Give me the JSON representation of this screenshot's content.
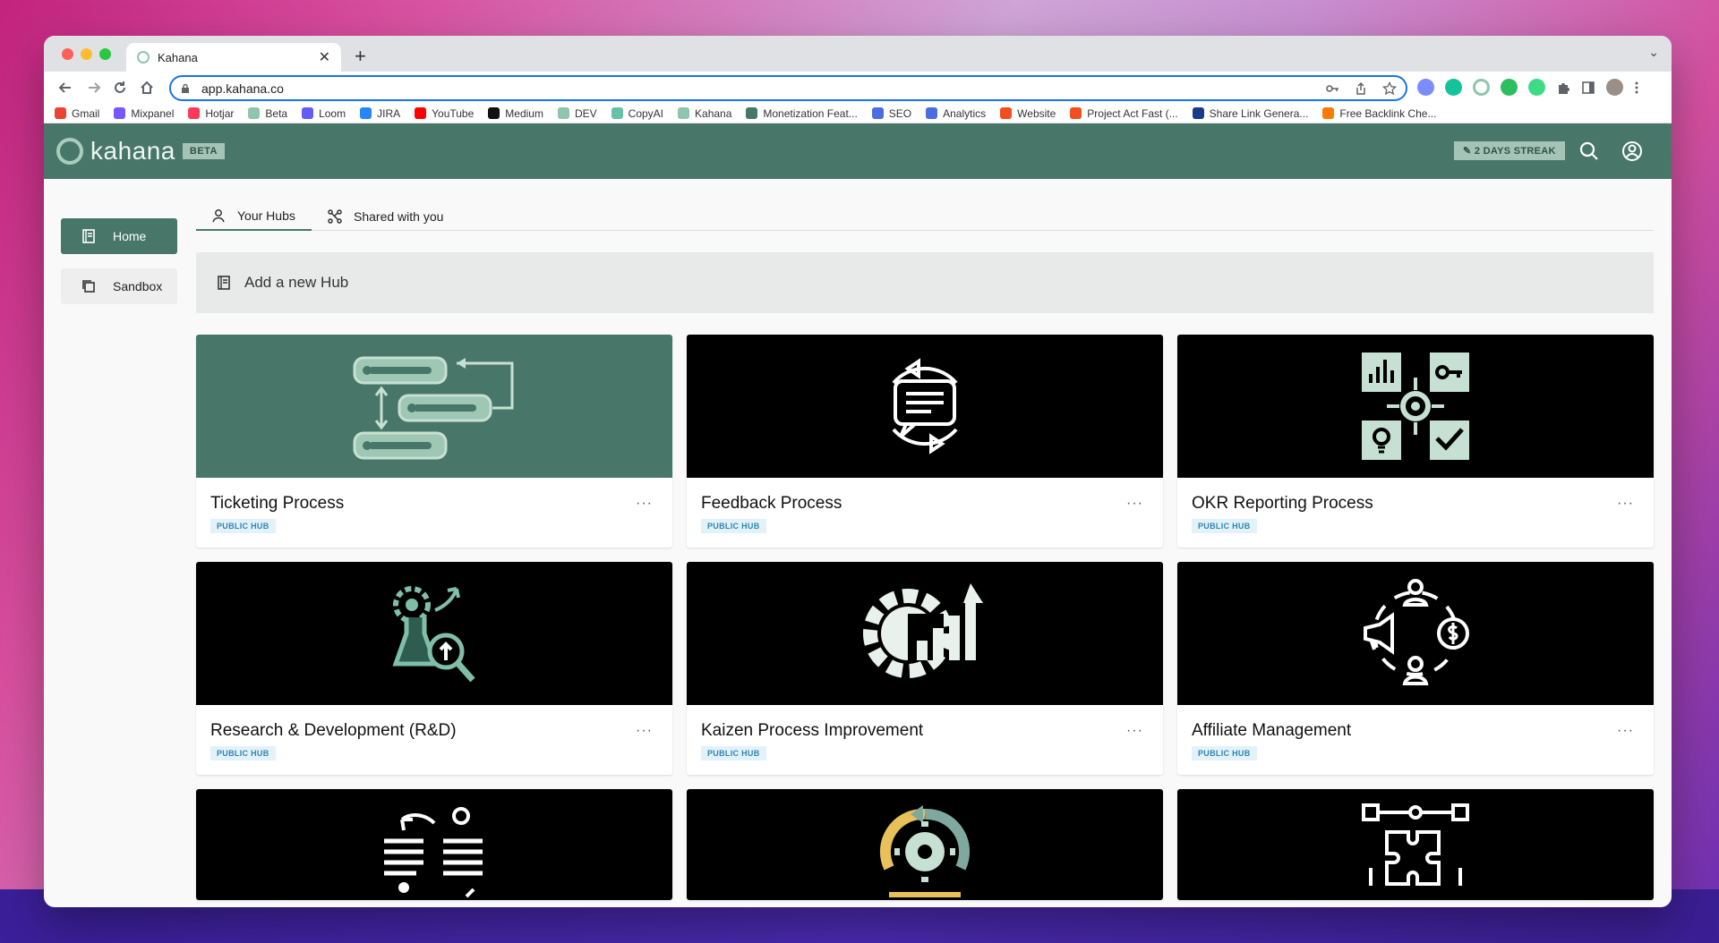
{
  "browser": {
    "tab_title": "Kahana",
    "tab_close": "✕",
    "new_tab": "+",
    "tab_menu": "⌄",
    "url": "app.kahana.co",
    "bookmarks": [
      {
        "label": "Gmail",
        "color": "#ea4335"
      },
      {
        "label": "Mixpanel",
        "color": "#7856ff"
      },
      {
        "label": "Hotjar",
        "color": "#fd3a5c"
      },
      {
        "label": "Beta",
        "color": "#8fc5ae"
      },
      {
        "label": "Loom",
        "color": "#625df5"
      },
      {
        "label": "JIRA",
        "color": "#2684ff"
      },
      {
        "label": "YouTube",
        "color": "#ff0000"
      },
      {
        "label": "Medium",
        "color": "#111111"
      },
      {
        "label": "DEV",
        "color": "#8fc5ae"
      },
      {
        "label": "CopyAI",
        "color": "#66c2a5"
      },
      {
        "label": "Kahana",
        "color": "#8fc5ae"
      },
      {
        "label": "Monetization Feat...",
        "color": "#48776a"
      },
      {
        "label": "SEO",
        "color": "#4a6ee0"
      },
      {
        "label": "Analytics",
        "color": "#4a6ee0"
      },
      {
        "label": "Website",
        "color": "#f24e1e"
      },
      {
        "label": "Project Act Fast (...",
        "color": "#f24e1e"
      },
      {
        "label": "Share Link Genera...",
        "color": "#1a3a8a"
      },
      {
        "label": "Free Backlink Che...",
        "color": "#ff7a00"
      }
    ]
  },
  "app": {
    "logo_text": "kahana",
    "beta_label": "BETA",
    "streak_label": "2 DAYS STREAK",
    "sidebar": {
      "items": [
        {
          "label": "Home",
          "active": true
        },
        {
          "label": "Sandbox",
          "active": false
        }
      ]
    },
    "tabs": [
      {
        "label": "Your Hubs",
        "active": true
      },
      {
        "label": "Shared with you",
        "active": false
      }
    ],
    "add_hub_label": "Add a new Hub",
    "more_label": "···",
    "hubs": [
      {
        "title": "Ticketing Process",
        "badge": "PUBLIC HUB",
        "icon": "ticketing-icon"
      },
      {
        "title": "Feedback Process",
        "badge": "PUBLIC HUB",
        "icon": "feedback-icon"
      },
      {
        "title": "OKR Reporting Process",
        "badge": "PUBLIC HUB",
        "icon": "okr-icon"
      },
      {
        "title": "Research & Development (R&D)",
        "badge": "PUBLIC HUB",
        "icon": "research-icon"
      },
      {
        "title": "Kaizen Process Improvement",
        "badge": "PUBLIC HUB",
        "icon": "kaizen-icon"
      },
      {
        "title": "Affiliate Management",
        "badge": "PUBLIC HUB",
        "icon": "affiliate-icon"
      }
    ],
    "colors": {
      "brand": "#48776a",
      "accent": "#a5c3b7"
    }
  }
}
